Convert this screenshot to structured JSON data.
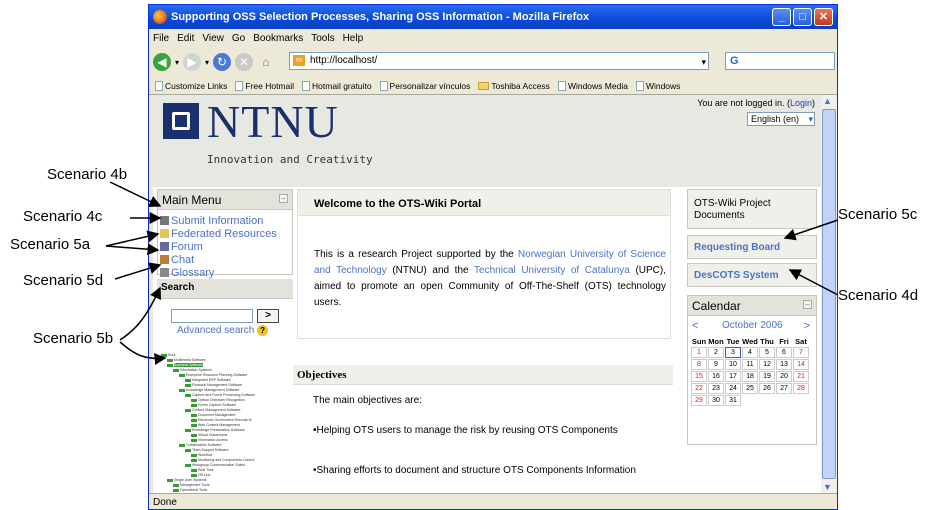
{
  "annotations": {
    "s4b": "Scenario 4b",
    "s4c": "Scenario 4c",
    "s5a": "Scenario 5a",
    "s5d": "Scenario 5d",
    "s5b": "Scenario 5b",
    "s5c": "Scenario 5c",
    "s4d": "Scenario 4d"
  },
  "window": {
    "title": "Supporting OSS Selection Processes, Sharing OSS Information - Mozilla Firefox",
    "menu": [
      "File",
      "Edit",
      "View",
      "Go",
      "Bookmarks",
      "Tools",
      "Help"
    ],
    "url": "http://localhost/",
    "search_glyph": "G",
    "bookmarks": [
      {
        "label": "Customize Links",
        "icon": "page-icon"
      },
      {
        "label": "Free Hotmail",
        "icon": "page-icon"
      },
      {
        "label": "Hotmail gratuito",
        "icon": "page-icon"
      },
      {
        "label": "Personalizar vínculos",
        "icon": "page-icon"
      },
      {
        "label": "Toshiba Access",
        "icon": "folder-icon"
      },
      {
        "label": "Windows Media",
        "icon": "page-icon"
      },
      {
        "label": "Windows",
        "icon": "page-icon"
      }
    ],
    "status": "Done"
  },
  "site": {
    "logo": "NTNU",
    "tagline": "Innovation and Creativity",
    "login_prefix": "You are not logged in. (",
    "login_link": "Login",
    "login_suffix": ")",
    "language": "English (en)"
  },
  "main_menu": {
    "title": "Main Menu",
    "items": [
      "Submit Information",
      "Federated Resources",
      "Forum",
      "Chat",
      "Glossary"
    ]
  },
  "search": {
    "title": "Search",
    "go": ">",
    "advanced": "Advanced search",
    "help": "?"
  },
  "welcome": {
    "title": "Welcome to the OTS-Wiki Portal",
    "p1": "This is a research Project supported by the ",
    "link1": "Norwegian University of Science and Technology",
    "p2": " (NTNU) and the ",
    "link2": "Technical University of Catalunya",
    "p3": " (UPC), aimed to promote an open Community of Off-The-Shelf (OTS) technology users."
  },
  "objectives": {
    "title": "Objectives",
    "intro": "The main objectives are:",
    "b1": "•Helping OTS users to manage the risk by reusing OTS Components",
    "b2": "•Sharing efforts to document and structure OTS Components Information"
  },
  "right": {
    "docs": "OTS-Wiki Project Documents",
    "board": "Requesting Board",
    "descots": "DesCOTS System"
  },
  "calendar": {
    "title": "Calendar",
    "prev": "<",
    "next": ">",
    "month": "October 2006",
    "days": [
      "Sun",
      "Mon",
      "Tue",
      "Wed",
      "Thu",
      "Fri",
      "Sat"
    ],
    "weeks": [
      [
        "1",
        "2",
        "3",
        "4",
        "5",
        "6",
        "7"
      ],
      [
        "8",
        "9",
        "10",
        "11",
        "12",
        "13",
        "14"
      ],
      [
        "15",
        "16",
        "17",
        "18",
        "19",
        "20",
        "21"
      ],
      [
        "22",
        "23",
        "24",
        "25",
        "26",
        "27",
        "28"
      ],
      [
        "29",
        "30",
        "31",
        "",
        "",
        "",
        ""
      ]
    ]
  },
  "tree": {
    "items": [
      "Root",
      "Multimedia Software",
      "Business Software",
      "Information Systems",
      "Enterprise Resource Planning Software",
      "Integrated ERP Software",
      "Financial Management Software",
      "Knowledge Management Software",
      "Capture and Forms Processing Software",
      "Optical Character Recognition",
      "Forms Capture Software",
      "Content Management Software",
      "Document Management",
      "Electronic Government Records M",
      "Web Content Management",
      "Knowledge Presentation Software",
      "Virtual Classrooms",
      "Information Access",
      "Collaboration Software",
      "Team Support Software",
      "Workflow",
      "Monitoring and Components Control",
      "Workgroup Communication Suites",
      "Real Time",
      "Off-Line",
      "Single User Systems",
      "Management Tools",
      "Operational Tools"
    ]
  }
}
